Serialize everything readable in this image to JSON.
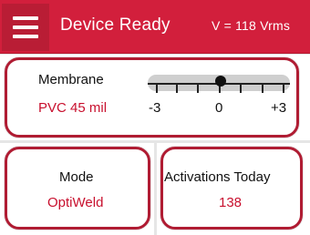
{
  "header": {
    "title": "Device Ready",
    "voltage": "V = 118 Vrms",
    "menu_icon": "hamburger-menu-icon"
  },
  "membrane": {
    "label": "Membrane",
    "value": "PVC 45 mil",
    "slider": {
      "min_label": "-3",
      "mid_label": "0",
      "max_label": "+3",
      "current": 0
    }
  },
  "mode": {
    "label": "Mode",
    "value": "OptiWeld"
  },
  "activations": {
    "label": "Activations Today",
    "value": "138"
  },
  "colors": {
    "accent": "#d21f3c",
    "value_text": "#c8102e",
    "card_border": "#b01c33"
  }
}
